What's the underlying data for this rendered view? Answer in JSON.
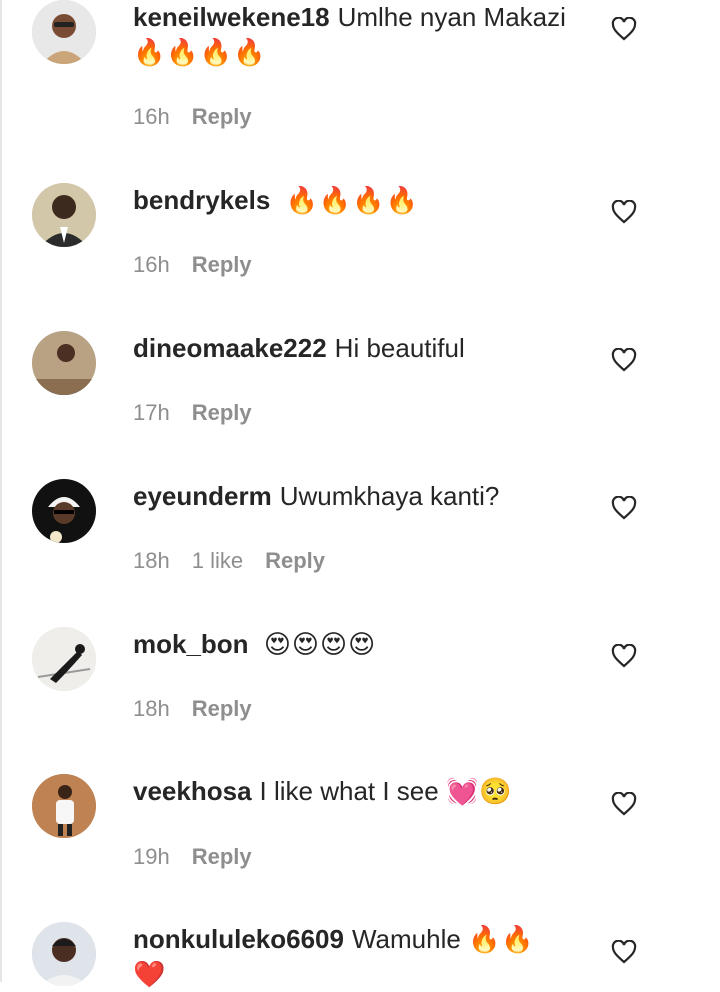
{
  "comments": [
    {
      "username": "keneilwekene18",
      "text": "Umlhe nyan Makazi",
      "emoji": "🔥🔥🔥🔥",
      "time": "16h",
      "likes": "",
      "reply": "Reply"
    },
    {
      "username": "bendrykels",
      "text": "",
      "emoji": "🔥🔥🔥🔥",
      "time": "16h",
      "likes": "",
      "reply": "Reply"
    },
    {
      "username": "dineomaake222",
      "text": "Hi beautiful",
      "emoji": "",
      "time": "17h",
      "likes": "",
      "reply": "Reply"
    },
    {
      "username": "eyeunderm",
      "text": "Uwumkhaya kanti?",
      "emoji": "",
      "time": "18h",
      "likes": "1 like",
      "reply": "Reply"
    },
    {
      "username": "mok_bon",
      "text": "",
      "emoji": "😍😍😍😍",
      "time": "18h",
      "likes": "",
      "reply": "Reply"
    },
    {
      "username": "veekhosa",
      "text": "I like what I see",
      "emoji": "💓🥺",
      "time": "19h",
      "likes": "",
      "reply": "Reply"
    },
    {
      "username": "nonkululeko6609",
      "text": "Wamuhle",
      "emoji": "🔥🔥 ❤️",
      "time": "",
      "likes": "",
      "reply": ""
    }
  ],
  "icons": {
    "like": "heart-outline-icon"
  },
  "colors": {
    "text": "#262626",
    "meta": "#8e8e8e",
    "background": "#ffffff"
  }
}
